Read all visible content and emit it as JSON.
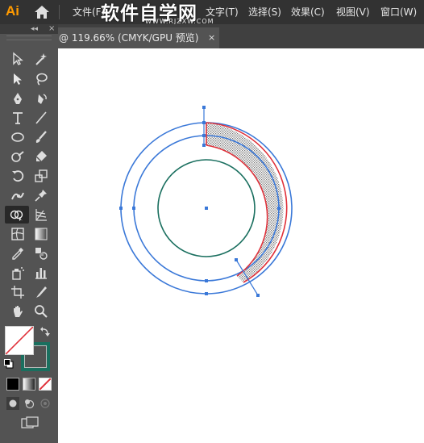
{
  "app": {
    "logo_text": "Ai",
    "menu": [
      "文件(F)",
      "文字(T)",
      "选择(S)",
      "效果(C)",
      "视图(V)",
      "窗口(W)"
    ],
    "watermark_title": "软件自学网",
    "watermark_url": "WWW.RJZXW.COM"
  },
  "document_tab": {
    "title": "@ 119.66% (CMYK/GPU 预览)",
    "close_symbol": "×"
  },
  "tool_panel": {
    "collapse_symbol": "◂◂",
    "close_symbol": "×",
    "tools": [
      "selection-tool",
      "magic-wand-tool",
      "direct-selection-tool",
      "lasso-tool",
      "pen-tool",
      "curvature-tool",
      "type-tool",
      "line-segment-tool",
      "ellipse-tool",
      "paintbrush-tool",
      "shaper-tool",
      "eraser-tool",
      "rotate-tool",
      "scale-tool",
      "puppet-warp-tool",
      "pin-tool",
      "shape-builder-tool",
      "perspective-grid-tool",
      "mesh-tool",
      "gradient-tool",
      "eyedropper-tool",
      "blend-tool",
      "symbol-sprayer-tool",
      "column-graph-tool",
      "artboard-tool",
      "slice-tool",
      "hand-tool",
      "zoom-tool"
    ],
    "active_tool": "shape-builder-tool",
    "fill": "none",
    "stroke_color": "#1a6f5f"
  },
  "colors": {
    "blue_path": "#3a78d8",
    "red_path": "#e0313a",
    "green_circle": "#1a6f5f",
    "anchor": "#3a78d8"
  }
}
